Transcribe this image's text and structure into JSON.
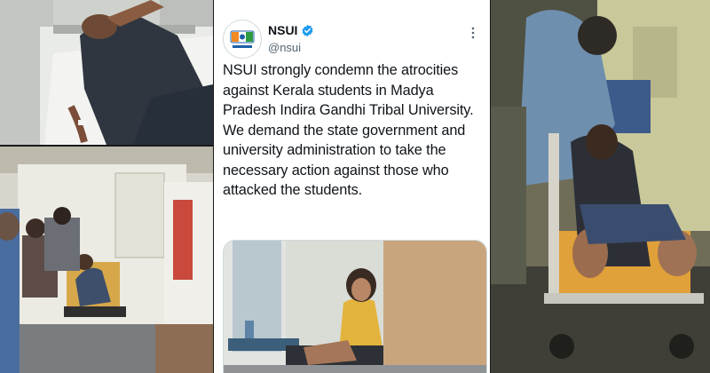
{
  "tweet": {
    "display_name": "NSUI",
    "handle": "@nsui",
    "verified": true,
    "text": "NSUI strongly condemn the atrocities against Kerala students in Madya Pradesh Indira Gandhi Tribal University. We demand the state government and university administration to take the necessary action against those who attacked the students.",
    "more_icon": "more-options-icon",
    "verified_icon": "verified-badge-icon"
  },
  "colors": {
    "verified_blue": "#1d9bf0",
    "text_primary": "#0f1419",
    "text_secondary": "#536471",
    "border": "#cfd9de"
  }
}
